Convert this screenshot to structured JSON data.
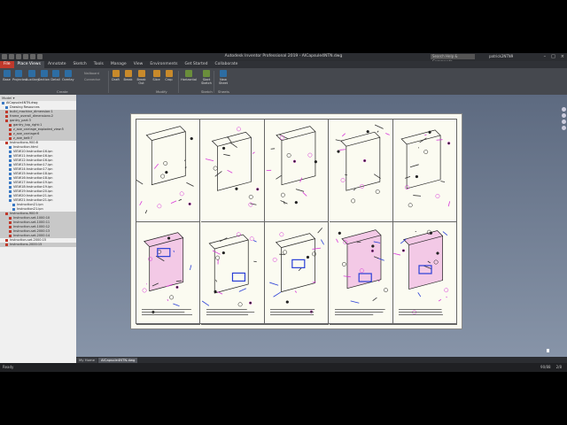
{
  "window": {
    "title": "Autodesk Inventor Professional 2019 - AICapsule4NTN.dwg",
    "search_placeholder": "Search Help & Commands...",
    "user": "patrick2NTN9",
    "controls": [
      "–",
      "□",
      "×"
    ]
  },
  "tabs": [
    "File",
    "Place Views",
    "Annotate",
    "Sketch",
    "Tools",
    "Manage",
    "View",
    "Environments",
    "Get Started",
    "Collaborate"
  ],
  "active_tab": "Place Views",
  "ribbon": {
    "create_buttons": [
      "Base",
      "Projected",
      "Auxiliary",
      "Section",
      "Detail",
      "Overlay"
    ],
    "small_buttons": [
      "Nailboard",
      "Connector"
    ],
    "modify_buttons": [
      "Draft",
      "Break",
      "Break Out",
      "Slice",
      "Crop"
    ],
    "sketch_buttons": [
      "Horizontal",
      "Start Sketch"
    ],
    "sheet_buttons": [
      "New Sheet"
    ],
    "panels": [
      "Create",
      "Modify",
      "Sketch",
      "Sheets"
    ]
  },
  "browser": {
    "header": "Model ▾",
    "items": [
      {
        "label": "AICapsule4NTN.dwg",
        "indent": 0,
        "icon": "doc"
      },
      {
        "label": "Drawing Resources",
        "indent": 1,
        "icon": "folder"
      },
      {
        "label": "build_machine_dimension:1",
        "indent": 1,
        "icon": "red",
        "shaded": true
      },
      {
        "label": "frame_overall_dimensions:2",
        "indent": 1,
        "icon": "red",
        "shaded": true
      },
      {
        "label": "gantry_part:3",
        "indent": 1,
        "icon": "red",
        "shaded": true
      },
      {
        "label": "gantry_top_right:1",
        "indent": 2,
        "icon": "red",
        "shaded": true
      },
      {
        "label": "z_axe_carriage_exploded_view:5",
        "indent": 2,
        "icon": "red",
        "shaded": true
      },
      {
        "label": "z_axe_carriage:6",
        "indent": 2,
        "icon": "red",
        "shaded": true
      },
      {
        "label": "z_axe_belt:7",
        "indent": 2,
        "icon": "red",
        "shaded": true
      },
      {
        "label": "Instructions-900:8",
        "indent": 1,
        "icon": "red"
      },
      {
        "label": "Instruction.html",
        "indent": 2,
        "icon": "doc"
      },
      {
        "label": "VIEW10:Instruction16.ipn",
        "indent": 2,
        "icon": "doc"
      },
      {
        "label": "VIEW11:Instruction16.ipn",
        "indent": 2,
        "icon": "doc"
      },
      {
        "label": "VIEW12:Instruction16.ipn",
        "indent": 2,
        "icon": "doc"
      },
      {
        "label": "VIEW13:Instruction17.ipn",
        "indent": 2,
        "icon": "doc"
      },
      {
        "label": "VIEW14:Instruction17.ipn",
        "indent": 2,
        "icon": "doc"
      },
      {
        "label": "VIEW15:Instruction18.ipn",
        "indent": 2,
        "icon": "doc"
      },
      {
        "label": "VIEW16:Instruction18.ipn",
        "indent": 2,
        "icon": "doc"
      },
      {
        "label": "VIEW17:Instruction19.ipn",
        "indent": 2,
        "icon": "doc"
      },
      {
        "label": "VIEW18:Instruction19.ipn",
        "indent": 2,
        "icon": "doc"
      },
      {
        "label": "VIEW19:Instruction20.ipn",
        "indent": 2,
        "icon": "doc"
      },
      {
        "label": "VIEW20:Instruction21.ipn",
        "indent": 2,
        "icon": "doc"
      },
      {
        "label": "VIEW21:Instruction21.ipn",
        "indent": 2,
        "icon": "doc"
      },
      {
        "label": "Instruction21.ipn",
        "indent": 3,
        "icon": "doc"
      },
      {
        "label": "Instruction21.ipn",
        "indent": 3,
        "icon": "doc"
      },
      {
        "label": "Instructions-900:9",
        "indent": 1,
        "icon": "red",
        "shaded": true
      },
      {
        "label": "Instruction-set-1000:10",
        "indent": 2,
        "icon": "red",
        "shaded": true
      },
      {
        "label": "Instruction-set-1000:11",
        "indent": 2,
        "icon": "red",
        "shaded": true
      },
      {
        "label": "Instruction-set-1000:12",
        "indent": 2,
        "icon": "red",
        "shaded": true
      },
      {
        "label": "Instruction-set-2000:13",
        "indent": 2,
        "icon": "red",
        "shaded": true
      },
      {
        "label": "Instruction-set-2000:14",
        "indent": 2,
        "icon": "red",
        "shaded": true
      },
      {
        "label": "Instruction-set-2000:15",
        "indent": 1,
        "icon": "red"
      },
      {
        "label": "Instructions-2000:15",
        "indent": 1,
        "icon": "red",
        "shaded": true
      }
    ]
  },
  "doc_tabs": [
    "My Home",
    "AICapsule4NTN.dwg"
  ],
  "active_doc": "AICapsule4NTN.dwg",
  "status": {
    "left": "Ready",
    "right": [
      "90/88",
      "2/8"
    ]
  },
  "colors": {
    "accent": "#c0392b",
    "magenta": "#d83ad8",
    "blue": "#2a3fd6"
  }
}
